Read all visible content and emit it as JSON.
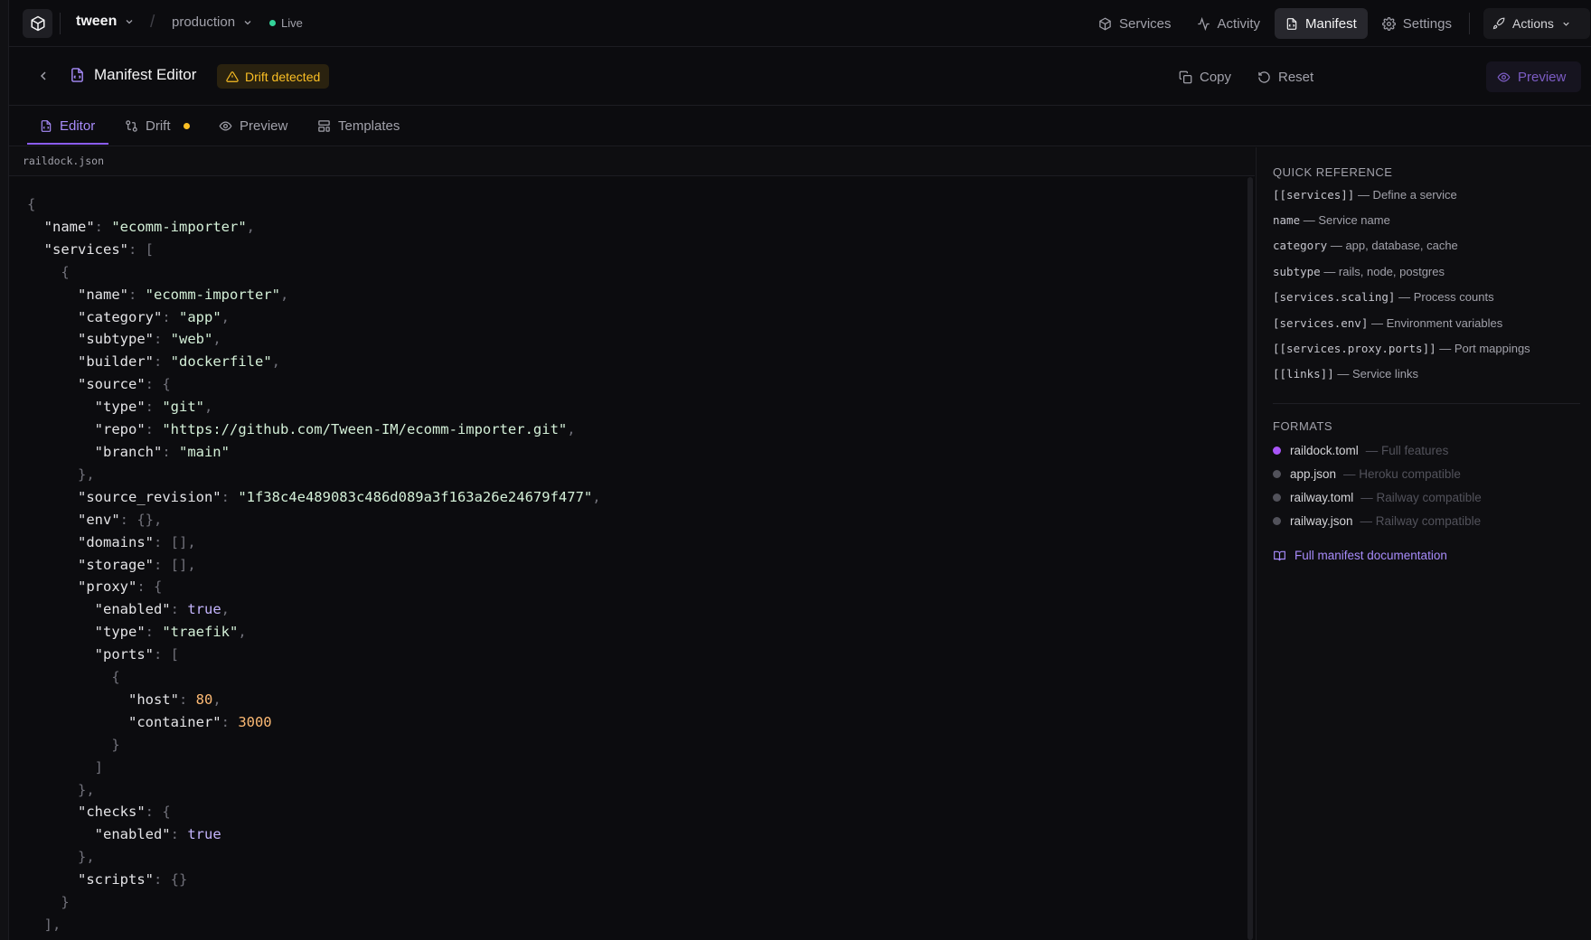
{
  "nav": {
    "project": "tween",
    "environment": "production",
    "live_label": "Live",
    "links": [
      {
        "label": "Services",
        "icon": "box-icon"
      },
      {
        "label": "Activity",
        "icon": "activity-icon"
      },
      {
        "label": "Manifest",
        "icon": "file-icon",
        "active": true
      },
      {
        "label": "Settings",
        "icon": "gear-icon"
      }
    ],
    "actions_label": "Actions"
  },
  "editor_header": {
    "title": "Manifest Editor",
    "drift_badge": "Drift detected",
    "copy_label": "Copy",
    "reset_label": "Reset",
    "preview_label": "Preview"
  },
  "tabs": [
    {
      "label": "Editor",
      "active": true
    },
    {
      "label": "Drift",
      "indicator": true
    },
    {
      "label": "Preview"
    },
    {
      "label": "Templates"
    }
  ],
  "file": {
    "name": "raildock.json"
  },
  "quick_reference": {
    "title": "QUICK REFERENCE",
    "items": [
      {
        "code": "[[services]]",
        "desc": "— Define a service"
      },
      {
        "code": "name",
        "desc": "— Service name"
      },
      {
        "code": "category",
        "desc": "— app, database, cache"
      },
      {
        "code": "subtype",
        "desc": "— rails, node, postgres"
      },
      {
        "code": "[services.scaling]",
        "desc": "— Process counts"
      },
      {
        "code": "[services.env]",
        "desc": "— Environment variables"
      },
      {
        "code": "[[services.proxy.ports]]",
        "desc": "— Port mappings"
      },
      {
        "code": "[[links]]",
        "desc": "— Service links"
      }
    ]
  },
  "formats": {
    "title": "FORMATS",
    "items": [
      {
        "name": "raildock.toml",
        "desc": "— Full features",
        "active": true
      },
      {
        "name": "app.json",
        "desc": "— Heroku compatible"
      },
      {
        "name": "railway.toml",
        "desc": "— Railway compatible"
      },
      {
        "name": "railway.json",
        "desc": "— Railway compatible"
      }
    ]
  },
  "doc_link": "Full manifest documentation",
  "colors": {
    "accent": "#8b5cf6",
    "live": "#34d399",
    "warning": "#fbbf24",
    "number": "#fdba74"
  }
}
